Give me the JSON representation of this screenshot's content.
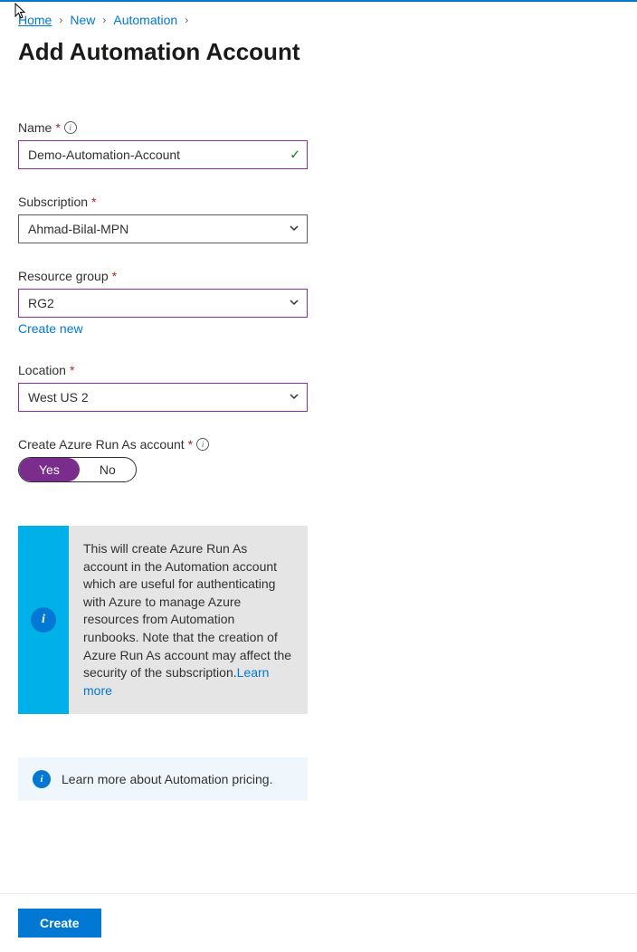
{
  "breadcrumb": {
    "items": [
      "Home",
      "New",
      "Automation"
    ]
  },
  "page": {
    "title": "Add Automation Account"
  },
  "form": {
    "name": {
      "label": "Name",
      "value": "Demo-Automation-Account"
    },
    "subscription": {
      "label": "Subscription",
      "value": "Ahmad-Bilal-MPN"
    },
    "resourceGroup": {
      "label": "Resource group",
      "value": "RG2",
      "createNew": "Create new"
    },
    "location": {
      "label": "Location",
      "value": "West US 2"
    },
    "runAs": {
      "label": "Create Azure Run As account",
      "yes": "Yes",
      "no": "No"
    }
  },
  "info": {
    "text": "This will create Azure Run As account in the Automation account which are useful for authenticating with Azure to manage Azure resources from Automation runbooks. Note that the creation of Azure Run As account may affect the security of the subscription.",
    "link": "Learn more"
  },
  "pricing": {
    "text": "Learn more about Automation pricing."
  },
  "footer": {
    "create": "Create"
  }
}
